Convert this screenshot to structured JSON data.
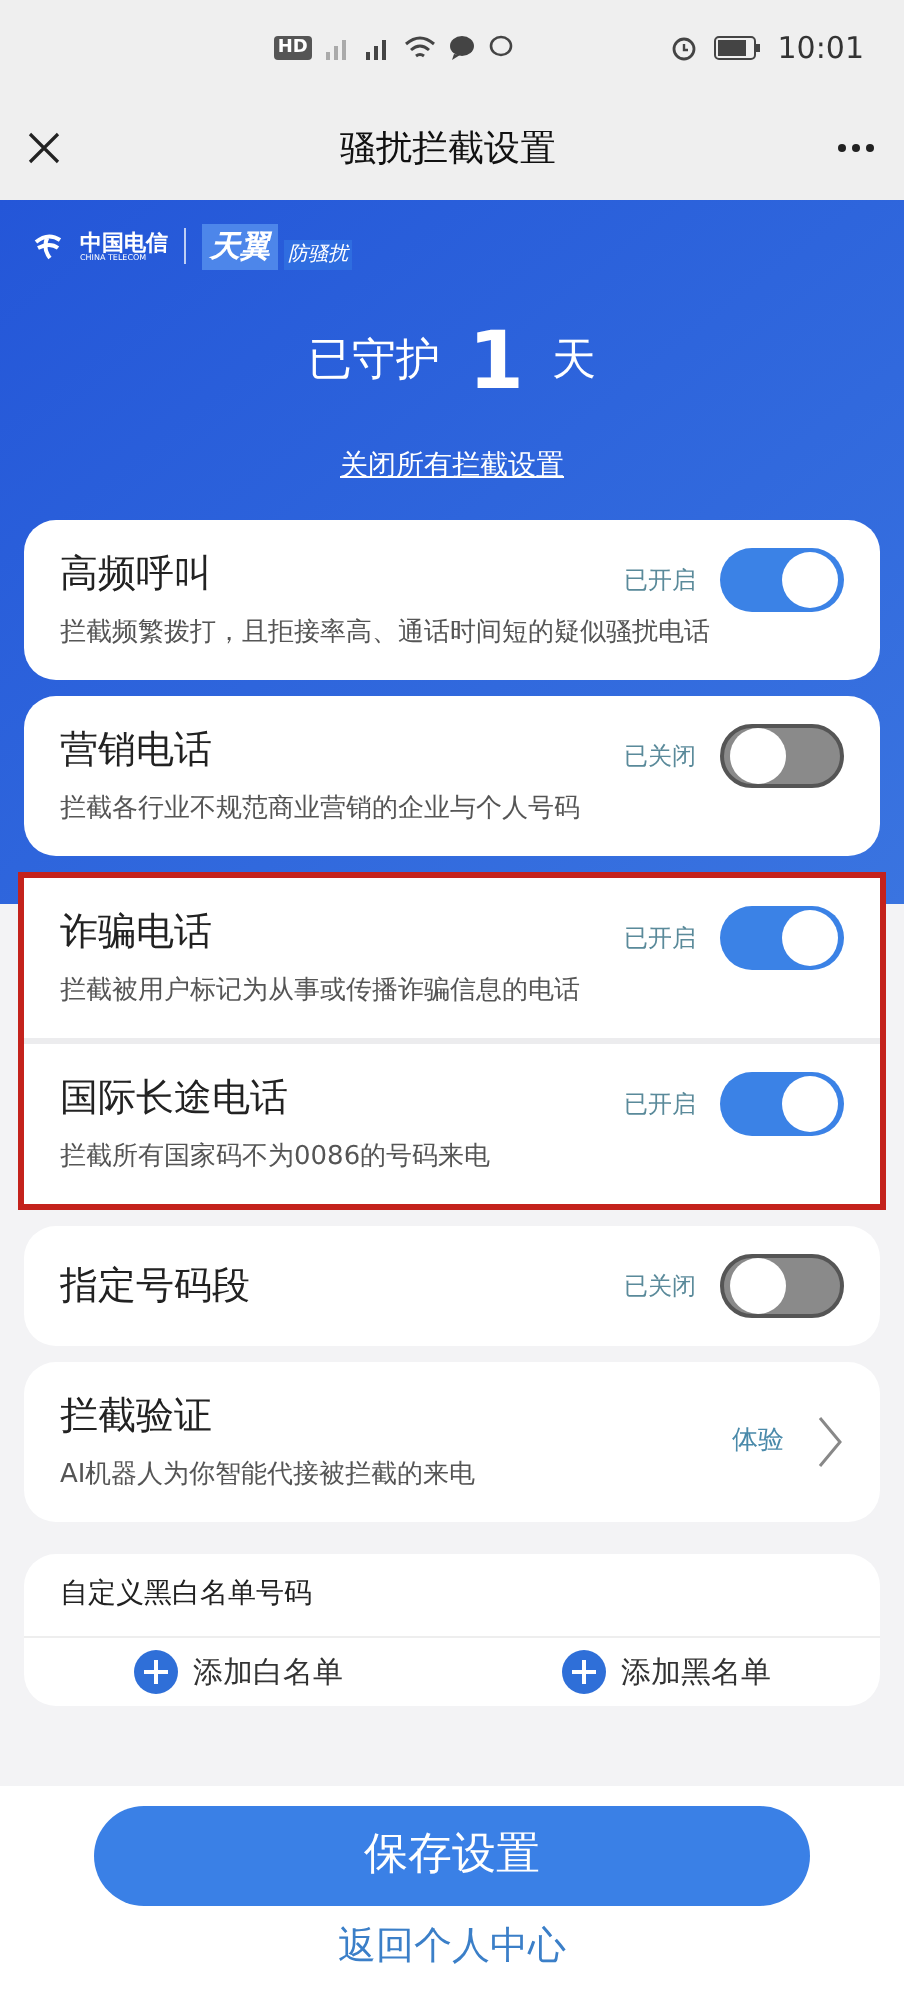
{
  "status_bar": {
    "badge": "HD",
    "time": "10:01"
  },
  "nav": {
    "title": "骚扰拦截设置"
  },
  "brand": {
    "name": "中国电信",
    "name_en": "CHINA TELECOM",
    "product": "天翼",
    "product_sub": "防骚扰"
  },
  "hero": {
    "prefix": "已守护",
    "days": "1",
    "suffix": "天",
    "link": "关闭所有拦截设置"
  },
  "settings": [
    {
      "kind": "toggle",
      "title": "高频呼叫",
      "description": "拦截频繁拨打，且拒接率高、通话时间短的疑似骚扰电话",
      "status": "已开启",
      "on": true,
      "highlighted": false
    },
    {
      "kind": "toggle",
      "title": "营销电话",
      "description": "拦截各行业不规范商业营销的企业与个人号码",
      "status": "已关闭",
      "on": false,
      "highlighted": false
    },
    {
      "kind": "toggle",
      "title": "诈骗电话",
      "description": "拦截被用户标记为从事或传播诈骗信息的电话",
      "status": "已开启",
      "on": true,
      "highlighted": true
    },
    {
      "kind": "toggle",
      "title": "国际长途电话",
      "description": "拦截所有国家码不为0086的号码来电",
      "status": "已开启",
      "on": true,
      "highlighted": true
    },
    {
      "kind": "toggle",
      "title": "指定号码段",
      "status": "已关闭",
      "on": false,
      "highlighted": false
    },
    {
      "kind": "link",
      "title": "拦截验证",
      "description": "AI机器人为你智能代接被拦截的来电",
      "action": "体验",
      "highlighted": false
    }
  ],
  "custom_list": {
    "title": "自定义黑白名单号码",
    "actions": [
      "添加白名单",
      "添加黑名单"
    ]
  },
  "footer": {
    "primary": "保存设置",
    "secondary": "返回个人中心"
  }
}
